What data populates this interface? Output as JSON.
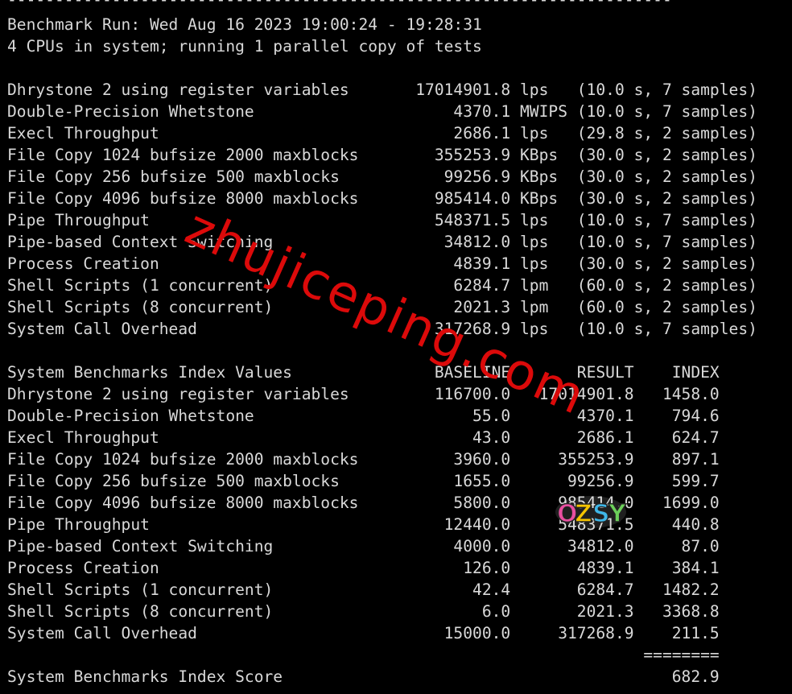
{
  "header": {
    "dashes": "----------------------------------------------------------------------",
    "run": "Benchmark Run: Wed Aug 16 2023 19:00:24 - 19:28:31",
    "cpus": "4 CPUs in system; running 1 parallel copy of tests"
  },
  "results": [
    "Dhrystone 2 using register variables       17014901.8 lps   (10.0 s, 7 samples)",
    "Double-Precision Whetstone                     4370.1 MWIPS (10.0 s, 7 samples)",
    "Execl Throughput                               2686.1 lps   (29.8 s, 2 samples)",
    "File Copy 1024 bufsize 2000 maxblocks        355253.9 KBps  (30.0 s, 2 samples)",
    "File Copy 256 bufsize 500 maxblocks           99256.9 KBps  (30.0 s, 2 samples)",
    "File Copy 4096 bufsize 8000 maxblocks        985414.0 KBps  (30.0 s, 2 samples)",
    "Pipe Throughput                              548371.5 lps   (10.0 s, 7 samples)",
    "Pipe-based Context Switching                  34812.0 lps   (10.0 s, 7 samples)",
    "Process Creation                               4839.1 lps   (30.0 s, 2 samples)",
    "Shell Scripts (1 concurrent)                   6284.7 lpm   (60.0 s, 2 samples)",
    "Shell Scripts (8 concurrent)                   2021.3 lpm   (60.0 s, 2 samples)",
    "System Call Overhead                         317268.9 lps   (10.0 s, 7 samples)"
  ],
  "index": {
    "header": "System Benchmarks Index Values               BASELINE       RESULT    INDEX",
    "rows": [
      "Dhrystone 2 using register variables         116700.0   17014901.8   1458.0",
      "Double-Precision Whetstone                       55.0       4370.1    794.6",
      "Execl Throughput                                 43.0       2686.1    624.7",
      "File Copy 1024 bufsize 2000 maxblocks          3960.0     355253.9    897.1",
      "File Copy 256 bufsize 500 maxblocks            1655.0      99256.9    599.7",
      "File Copy 4096 bufsize 8000 maxblocks          5800.0     985414.0   1699.0",
      "Pipe Throughput                               12440.0     548371.5    440.8",
      "Pipe-based Context Switching                   4000.0      34812.0     87.0",
      "Process Creation                                126.0       4839.1    384.1",
      "Shell Scripts (1 concurrent)                     42.4       6284.7   1482.2",
      "Shell Scripts (8 concurrent)                      6.0       2021.3   3368.8",
      "System Call Overhead                          15000.0     317268.9    211.5"
    ],
    "separator": "                                                                   ========",
    "score": "System Benchmarks Index Score                                         682.9"
  },
  "watermark": {
    "text": "zhujiceping.com",
    "color": "#dc0a0a"
  },
  "logo": {
    "text": "OZSY",
    "colors": [
      "#e84fa0",
      "#f5c400",
      "#3fb7e8",
      "#6cd05a"
    ]
  }
}
